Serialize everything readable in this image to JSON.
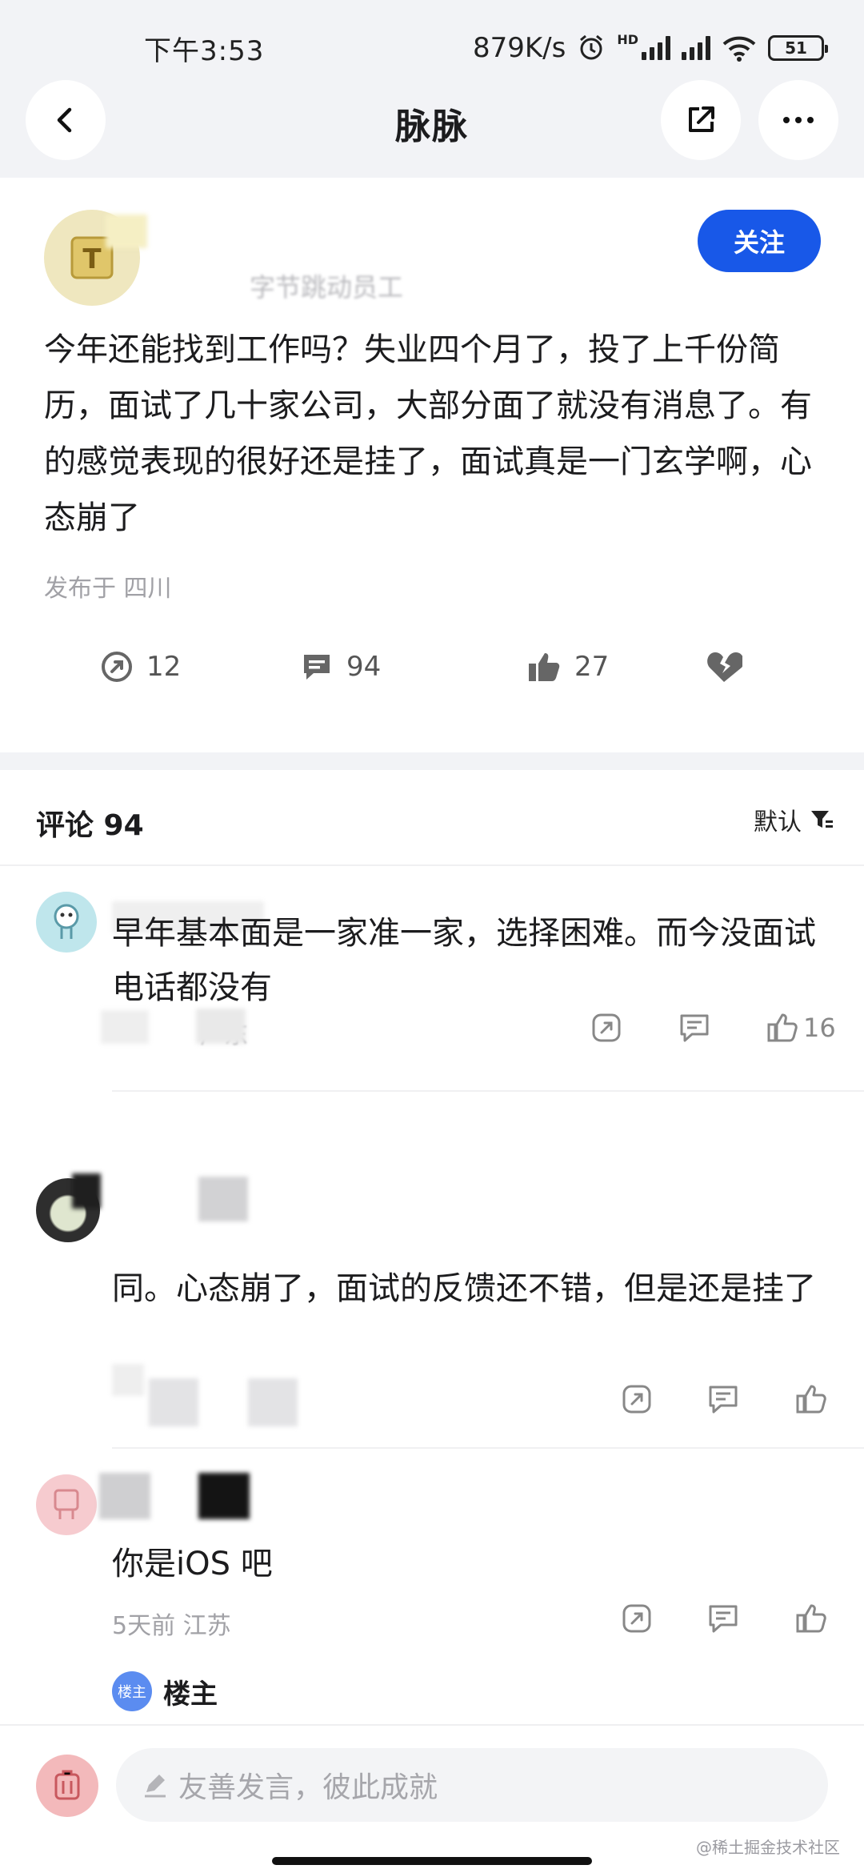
{
  "status_bar": {
    "time": "下午3:53",
    "speed": "879K/s",
    "hd": "HD",
    "battery": "51"
  },
  "nav": {
    "title": "脉脉"
  },
  "post": {
    "follow_label": "关注",
    "author_sub": "字节跳动员工",
    "content": "今年还能找到工作吗？失业四个月了，投了上千份简历，面试了几十家公司，大部分面了就没有消息了。有的感觉表现的很好还是挂了，面试真是一门玄学啊，心态崩了",
    "location": "发布于 四川",
    "actions": {
      "share_count": "12",
      "comment_count": "94",
      "like_count": "27"
    }
  },
  "comments": {
    "header": "评论 94",
    "sort_label": "默认",
    "items": [
      {
        "text": "早年基本面是一家准一家，选择困难。而今没面试电话都没有",
        "meta": "广东",
        "like_count": "16"
      },
      {
        "text": "同。心态崩了，面试的反馈还不错，但是还是挂了"
      },
      {
        "text": "你是iOS 吧",
        "meta": "5天前  江苏"
      }
    ],
    "reply": {
      "badge": "楼主",
      "name": "楼主"
    }
  },
  "bottom": {
    "placeholder": "友善发言，彼此成就",
    "watermark": "@稀土掘金技术社区"
  },
  "colors": {
    "accent": "#1858e8",
    "text": "#1c1c1e",
    "muted": "#a1a1a6"
  }
}
